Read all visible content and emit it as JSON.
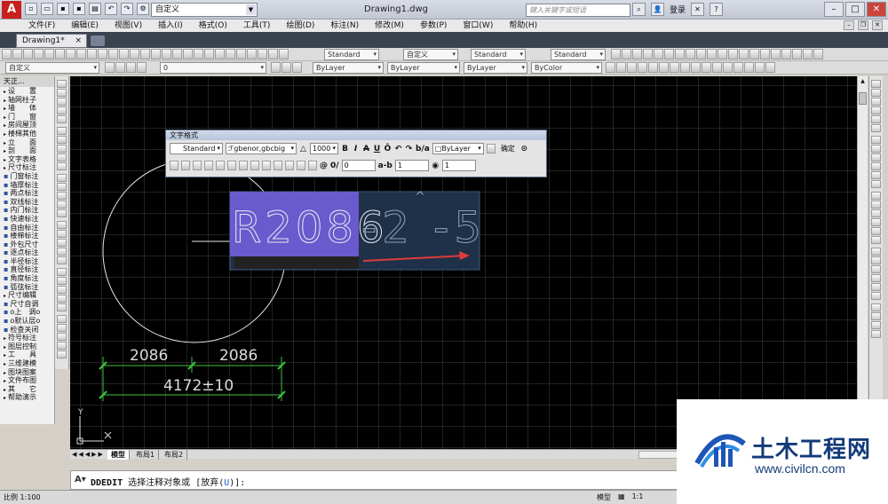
{
  "titlebar": {
    "app_icon": "A",
    "workspace": "自定义",
    "title": "Drawing1.dwg",
    "search_placeholder": "键入关键字或短语",
    "login": "登录"
  },
  "menu": [
    "文件(F)",
    "编辑(E)",
    "视图(V)",
    "插入(I)",
    "格式(O)",
    "工具(T)",
    "绘图(D)",
    "标注(N)",
    "修改(M)",
    "参数(P)",
    "窗口(W)",
    "帮助(H)"
  ],
  "tabs": {
    "doc_tab": "Drawing1*",
    "close": "×"
  },
  "toolbar": {
    "text_style": "Standard",
    "dim_style": "自定义",
    "table_style": "Standard",
    "mleader_style": "Standard",
    "workspace2": "自定义",
    "layer": "0",
    "color": "ByLayer",
    "linetype": "ByLayer",
    "lineweight": "ByLayer",
    "plotstyle": "ByColor"
  },
  "palette": {
    "title": "天正...",
    "items": [
      {
        "label": "设　　置",
        "kind": "arrow"
      },
      {
        "label": "轴网柱子",
        "kind": "arrow"
      },
      {
        "label": "墙　　体",
        "kind": "arrow"
      },
      {
        "label": "门　　窗",
        "kind": "arrow"
      },
      {
        "label": "房间屋顶",
        "kind": "arrow"
      },
      {
        "label": "楼梯其他",
        "kind": "arrow"
      },
      {
        "label": "立　　面",
        "kind": "arrow"
      },
      {
        "label": "剖　　面",
        "kind": "arrow"
      },
      {
        "label": "文字表格",
        "kind": "arrow"
      },
      {
        "label": "尺寸标注",
        "kind": "arrow"
      },
      {
        "label": "门窗标注",
        "kind": "ico"
      },
      {
        "label": "墙厚标注",
        "kind": "ico"
      },
      {
        "label": "两点标注",
        "kind": "ico"
      },
      {
        "label": "双线标注",
        "kind": "ico"
      },
      {
        "label": "内门标注",
        "kind": "ico"
      },
      {
        "label": "快速标注",
        "kind": "ico"
      },
      {
        "label": "自由标注",
        "kind": "ico"
      },
      {
        "label": "楼梯标注",
        "kind": "ico"
      },
      {
        "label": "外包尺寸",
        "kind": "ico"
      },
      {
        "label": "逐点标注",
        "kind": "ico"
      },
      {
        "label": "半径标注",
        "kind": "ico"
      },
      {
        "label": "直径标注",
        "kind": "ico"
      },
      {
        "label": "角度标注",
        "kind": "ico"
      },
      {
        "label": "弧弦标注",
        "kind": "ico"
      },
      {
        "label": "尺寸编辑",
        "kind": "arrow"
      },
      {
        "label": "尺寸自调",
        "kind": "ico"
      },
      {
        "label": "o上　调o",
        "kind": "ico"
      },
      {
        "label": "o默认层o",
        "kind": "ico"
      },
      {
        "label": "检查关闭",
        "kind": "ico"
      },
      {
        "label": "符号标注",
        "kind": "arrow"
      },
      {
        "label": "图层控制",
        "kind": "arrow"
      },
      {
        "label": "工　　具",
        "kind": "arrow"
      },
      {
        "label": "三维建模",
        "kind": "arrow"
      },
      {
        "label": "图块图案",
        "kind": "arrow"
      },
      {
        "label": "文件布图",
        "kind": "arrow"
      },
      {
        "label": "其　　它",
        "kind": "arrow"
      },
      {
        "label": "帮助演示",
        "kind": "arrow"
      }
    ]
  },
  "textformat": {
    "title": "文字格式",
    "style": "Standard",
    "font": "gbenor,gbcbig",
    "height": "1000",
    "bold": "B",
    "italic": "I",
    "strike": "A",
    "underline": "U",
    "overline": "Ō",
    "color": "ByLayer",
    "ok": "确定",
    "oblique": "0",
    "tracking": "1",
    "width": "1"
  },
  "drawing": {
    "mtext": "R2086",
    "mtext_rest": "-2  -5",
    "caret": "^",
    "dim_left": "2086",
    "dim_right": "2086",
    "dim_total": "4172±10",
    "ucs_y": "Y"
  },
  "layout_tabs": [
    "模型",
    "布局1",
    "布局2"
  ],
  "command": {
    "name": "DDEDIT",
    "prompt": "选择注释对象或",
    "option_open": "[放弃(",
    "option_key": "U",
    "option_close": ")]:"
  },
  "status": {
    "scale": "比例 1:100",
    "model": "模型",
    "anno_scale": "1:1"
  },
  "watermark": {
    "name": "土木工程网",
    "url": "www.civilcn.com"
  }
}
